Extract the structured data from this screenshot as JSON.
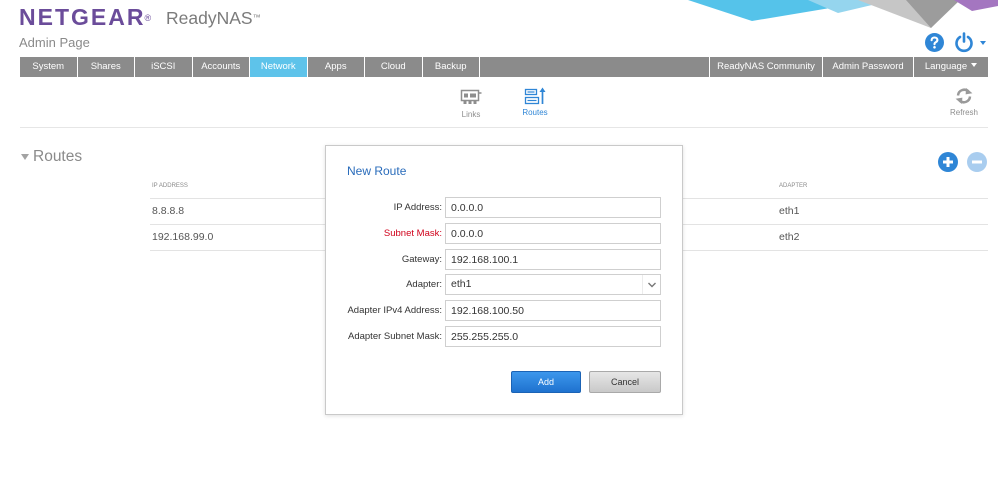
{
  "brand": {
    "logo": "NETGEAR",
    "logo_mark": "®",
    "product": "ReadyNAS",
    "product_mark": "™",
    "page_title": "Admin Page"
  },
  "header": {
    "help_icon": "help-icon",
    "power_icon": "power-icon"
  },
  "nav": {
    "tabs": [
      {
        "label": "System"
      },
      {
        "label": "Shares"
      },
      {
        "label": "iSCSI"
      },
      {
        "label": "Accounts"
      },
      {
        "label": "Network",
        "active": true
      },
      {
        "label": "Apps"
      },
      {
        "label": "Cloud"
      },
      {
        "label": "Backup"
      }
    ],
    "right_tabs": [
      {
        "label": "ReadyNAS Community"
      },
      {
        "label": "Admin Password"
      },
      {
        "label": "Language"
      }
    ]
  },
  "toolbar": {
    "items": [
      {
        "label": "Links",
        "icon": "links-icon"
      },
      {
        "label": "Routes",
        "icon": "routes-icon",
        "active": true
      }
    ],
    "refresh": {
      "label": "Refresh",
      "icon": "refresh-icon"
    }
  },
  "routes": {
    "section_title": "Routes",
    "columns": {
      "ip_address": "IP ADDRESS",
      "adapter": "ADAPTER"
    },
    "rows": [
      {
        "ip_address": "8.8.8.8",
        "adapter": "eth1"
      },
      {
        "ip_address": "192.168.99.0",
        "adapter": "eth2"
      }
    ]
  },
  "dialog": {
    "title": "New Route",
    "fields": [
      {
        "label": "IP Address:",
        "value": "0.0.0.0"
      },
      {
        "label": "Subnet Mask:",
        "value": "0.0.0.0",
        "invalid": true
      },
      {
        "label": "Gateway:",
        "value": "192.168.100.1"
      },
      {
        "label": "Adapter:",
        "value": "eth1"
      },
      {
        "label": "Adapter IPv4 Address:",
        "value": "192.168.100.50"
      },
      {
        "label": "Adapter Subnet Mask:",
        "value": "255.255.255.0"
      }
    ],
    "add_label": "Add",
    "cancel_label": "Cancel"
  },
  "colors": {
    "brand": "#6b4c9a",
    "nav_bg": "#8b8b8b",
    "nav_active": "#5ec3ea",
    "accent": "#2f86d6",
    "error": "#d0021b"
  }
}
